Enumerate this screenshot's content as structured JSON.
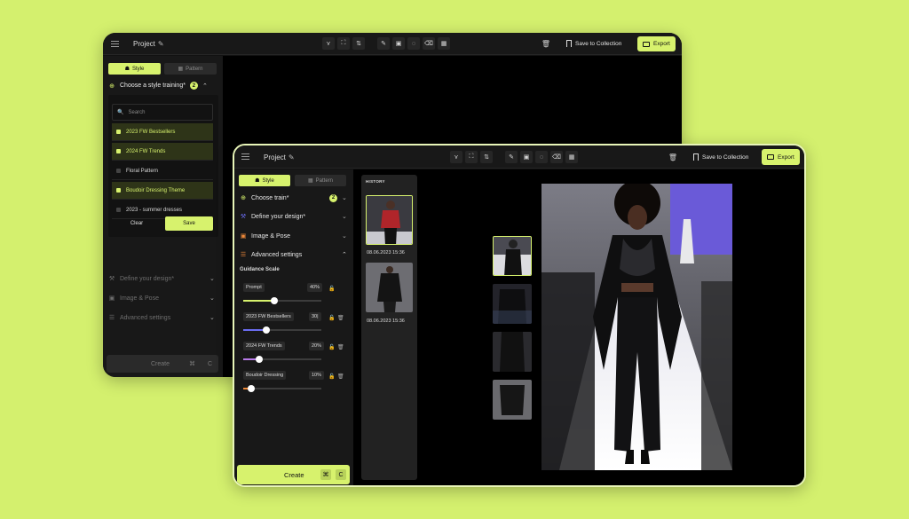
{
  "back_window": {
    "project_title": "Project",
    "save_to_collection": "Save to Collection",
    "export": "Export",
    "tabs": {
      "style": "Style",
      "pattern": "Pattern"
    },
    "style_section": {
      "title": "Choose a style training*",
      "count": "2"
    },
    "search_placeholder": "Search",
    "options": [
      {
        "label": "2023 FW Bestsellers",
        "selected": true
      },
      {
        "label": "2024 FW Trends",
        "selected": true
      },
      {
        "label": "Floral Pattern",
        "selected": false
      },
      {
        "label": "Boudoir Dressing Theme",
        "selected": true
      },
      {
        "label": "2023 - summer dresses",
        "selected": false
      }
    ],
    "clear": "Clear",
    "save": "Save",
    "sections": [
      "Define your design*",
      "Image & Pose",
      "Advanced settings"
    ],
    "create": "Create",
    "keys": [
      "⌘",
      "C"
    ]
  },
  "front_window": {
    "project_title": "Project",
    "save_to_collection": "Save to Collection",
    "export": "Export",
    "tabs": {
      "style": "Style",
      "pattern": "Pattern"
    },
    "sections": {
      "choose_train": "Choose train*",
      "choose_train_count": "2",
      "define_design": "Define your design*",
      "image_pose": "Image & Pose",
      "advanced": "Advanced settings"
    },
    "guidance_scale": "Guidance Scale",
    "sliders": [
      {
        "label": "Prompt",
        "value": "40%",
        "fraction": 0.4,
        "color": "#d7f26d"
      },
      {
        "label": "2023 FW Bestsellers",
        "value": "30|",
        "fraction": 0.3,
        "color": "#6a6cf0"
      },
      {
        "label": "2024 FW Trends",
        "value": "20%",
        "fraction": 0.2,
        "color": "#b77ae8"
      },
      {
        "label": "Boudoir Dressing",
        "value": "10%",
        "fraction": 0.1,
        "color": "#f08a3a"
      }
    ],
    "create": "Create",
    "keys": [
      "⌘",
      "C"
    ],
    "history": {
      "title": "HISTORY",
      "items": [
        {
          "time": "08.06.2023 15:36"
        },
        {
          "time": "08.06.2023 15:36"
        }
      ]
    }
  },
  "colors": {
    "accent": "#d7f26d",
    "background": "#d4f06e",
    "panel": "#121212"
  }
}
